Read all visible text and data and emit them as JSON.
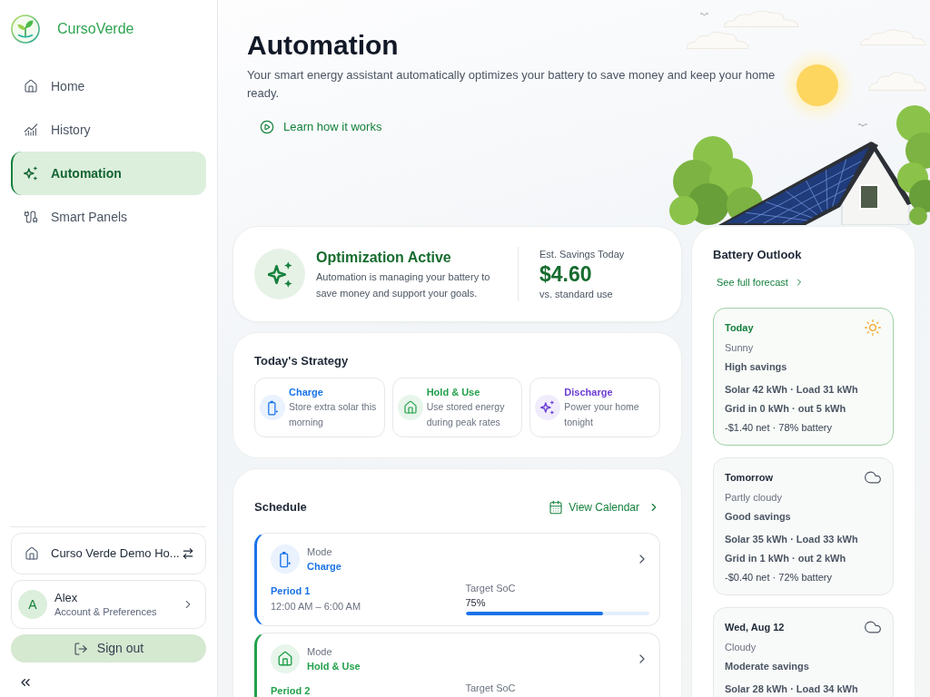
{
  "sidebar": {
    "brand": "CursoVerde",
    "nav": [
      {
        "label": "Home",
        "selected": false
      },
      {
        "label": "History",
        "selected": false
      },
      {
        "label": "Automation",
        "selected": true
      },
      {
        "label": "Smart Panels",
        "selected": false
      }
    ],
    "home_selector": {
      "label": "Curso Verde Demo Ho..."
    },
    "account": {
      "initial": "A",
      "name": "Alex",
      "subtitle": "Account & Preferences"
    },
    "sign_out": "Sign out"
  },
  "header": {
    "title": "Automation",
    "subtitle": "Your smart energy assistant automatically optimizes your battery to save money and keep your home ready.",
    "link": "Learn how it works"
  },
  "optimization": {
    "title": "Optimization Active",
    "description": "Automation is managing your battery to save money and support your goals.",
    "savings_label": "Est. Savings Today",
    "savings_value": "$4.60",
    "savings_note": "vs. standard use"
  },
  "strategy": {
    "title": "Today's Strategy",
    "items": [
      {
        "kind": "charge",
        "title": "Charge",
        "description": "Store extra solar this morning"
      },
      {
        "kind": "hold",
        "title": "Hold & Use",
        "description": "Use stored energy during peak rates"
      },
      {
        "kind": "discharge",
        "title": "Discharge",
        "description": "Power your home tonight"
      }
    ]
  },
  "schedule": {
    "title": "Schedule",
    "calendar_link": "View Calendar",
    "periods": [
      {
        "kind": "charge",
        "mode_label": "Mode",
        "mode": "Charge",
        "period": "Period 1",
        "time": "12:00 AM – 6:00 AM",
        "target_label": "Target SoC",
        "target": "75%",
        "level": 0.75
      },
      {
        "kind": "hold",
        "mode_label": "Mode",
        "mode": "Hold & Use",
        "period": "Period 2",
        "target_label": "Target SoC"
      }
    ]
  },
  "battery_outlook": {
    "title": "Battery Outlook",
    "forecast_link": "See full forecast",
    "days": [
      {
        "day": "Today",
        "selected": true,
        "kind": "sunny",
        "condition": "Sunny",
        "savings": "High savings",
        "energy": [
          "Solar 42 kWh · Load 31 kWh",
          "Grid in 0 kWh · out 5 kWh"
        ],
        "net": "-$1.40 net · 78% battery"
      },
      {
        "day": "Tomorrow",
        "selected": false,
        "kind": "cloudy",
        "condition": "Partly cloudy",
        "savings": "Good savings",
        "energy": [
          "Solar 35 kWh · Load 33 kWh",
          "Grid in 1 kWh · out 2 kWh"
        ],
        "net": "-$0.40 net · 72% battery"
      },
      {
        "day": "Wed, Aug 12",
        "selected": false,
        "kind": "cloudy",
        "condition": "Cloudy",
        "savings": "Moderate savings",
        "energy": [
          "Solar 28 kWh · Load 34 kWh"
        ]
      }
    ]
  }
}
